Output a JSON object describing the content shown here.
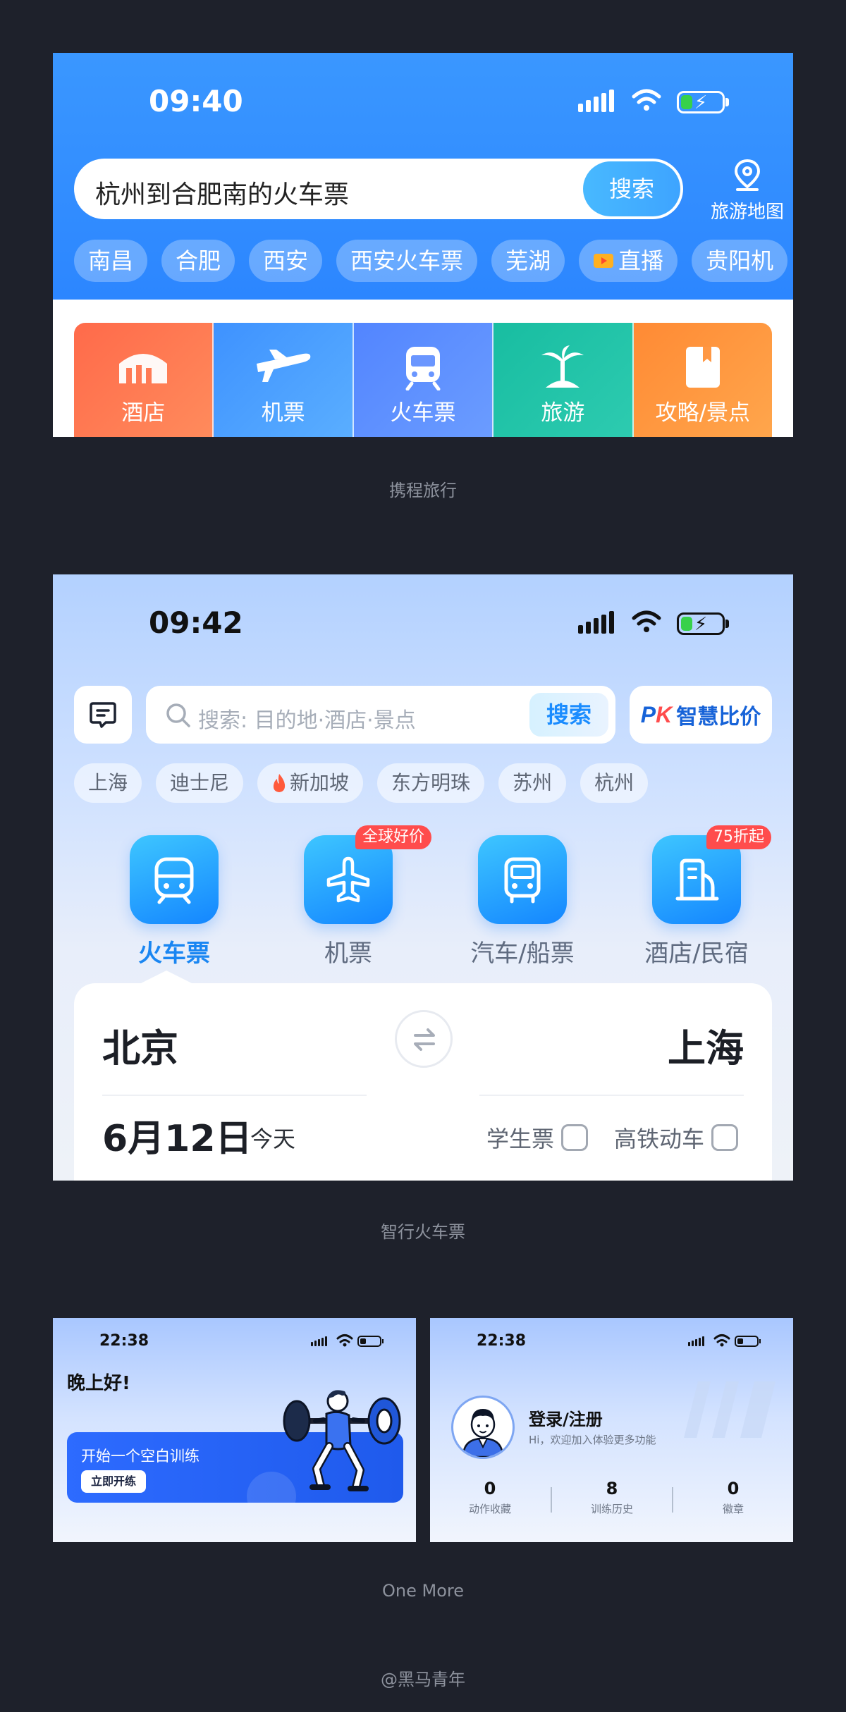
{
  "colors": {
    "page_bg": "#1e212b",
    "ctrip_blue": "#2c86ff",
    "zhixing_blue": "#1a86f2",
    "onemore_blue": "#2d6bff",
    "badge_red": "#ff4c4c",
    "caption_gray": "#8d929d"
  },
  "ctrip": {
    "caption": "携程旅行",
    "time": "09:40",
    "search": {
      "query": "杭州到合肥南的火车票",
      "button": "搜索"
    },
    "map_button": {
      "label": "旅游地图",
      "icon": "map-pin-icon"
    },
    "chips": [
      "南昌",
      "合肥",
      "西安",
      "西安火车票",
      "芜湖",
      "直播",
      "贵阳机"
    ],
    "tiles": [
      {
        "label": "酒店",
        "icon": "hotel-icon",
        "color": "#ff6a4a"
      },
      {
        "label": "机票",
        "icon": "plane-icon",
        "color": "#4a9dff"
      },
      {
        "label": "火车票",
        "icon": "train-icon",
        "color": "#5d8cff"
      },
      {
        "label": "旅游",
        "icon": "palm-tree-icon",
        "color": "#22c0a5"
      },
      {
        "label": "攻略/景点",
        "icon": "guidebook-icon",
        "color": "#ff8f3a"
      }
    ]
  },
  "zhixing": {
    "caption": "智行火车票",
    "time": "09:42",
    "search": {
      "placeholder": "搜索: 目的地·酒店·景点",
      "button": "搜索"
    },
    "pk": {
      "mark": "PK",
      "label": "智慧比价"
    },
    "chips": [
      "上海",
      "迪士尼",
      "新加坡",
      "东方明珠",
      "苏州",
      "杭州"
    ],
    "categories": [
      {
        "label": "火车票",
        "icon": "train-icon",
        "badge": "",
        "active": true
      },
      {
        "label": "机票",
        "icon": "plane-icon",
        "badge": "全球好价",
        "active": false
      },
      {
        "label": "汽车/船票",
        "icon": "bus-icon",
        "badge": "",
        "active": false
      },
      {
        "label": "酒店/民宿",
        "icon": "building-icon",
        "badge": "75折起",
        "active": false
      }
    ],
    "booking": {
      "from": "北京",
      "to": "上海",
      "date": "6月12日",
      "date_note": "今天",
      "option_student": "学生票",
      "option_highspeed": "高铁动车"
    }
  },
  "onemore": {
    "caption": "One More",
    "home": {
      "time": "22:38",
      "greeting": "晚上好!",
      "card_title": "开始一个空白训练",
      "card_button": "立即开练"
    },
    "profile": {
      "time": "22:38",
      "login": "登录/注册",
      "subtitle": "Hi，欢迎加入体验更多功能",
      "stats": [
        {
          "value": "0",
          "label": "动作收藏"
        },
        {
          "value": "8",
          "label": "训练历史"
        },
        {
          "value": "0",
          "label": "徽章"
        }
      ]
    }
  },
  "footer": {
    "credit": "@黑马青年"
  }
}
